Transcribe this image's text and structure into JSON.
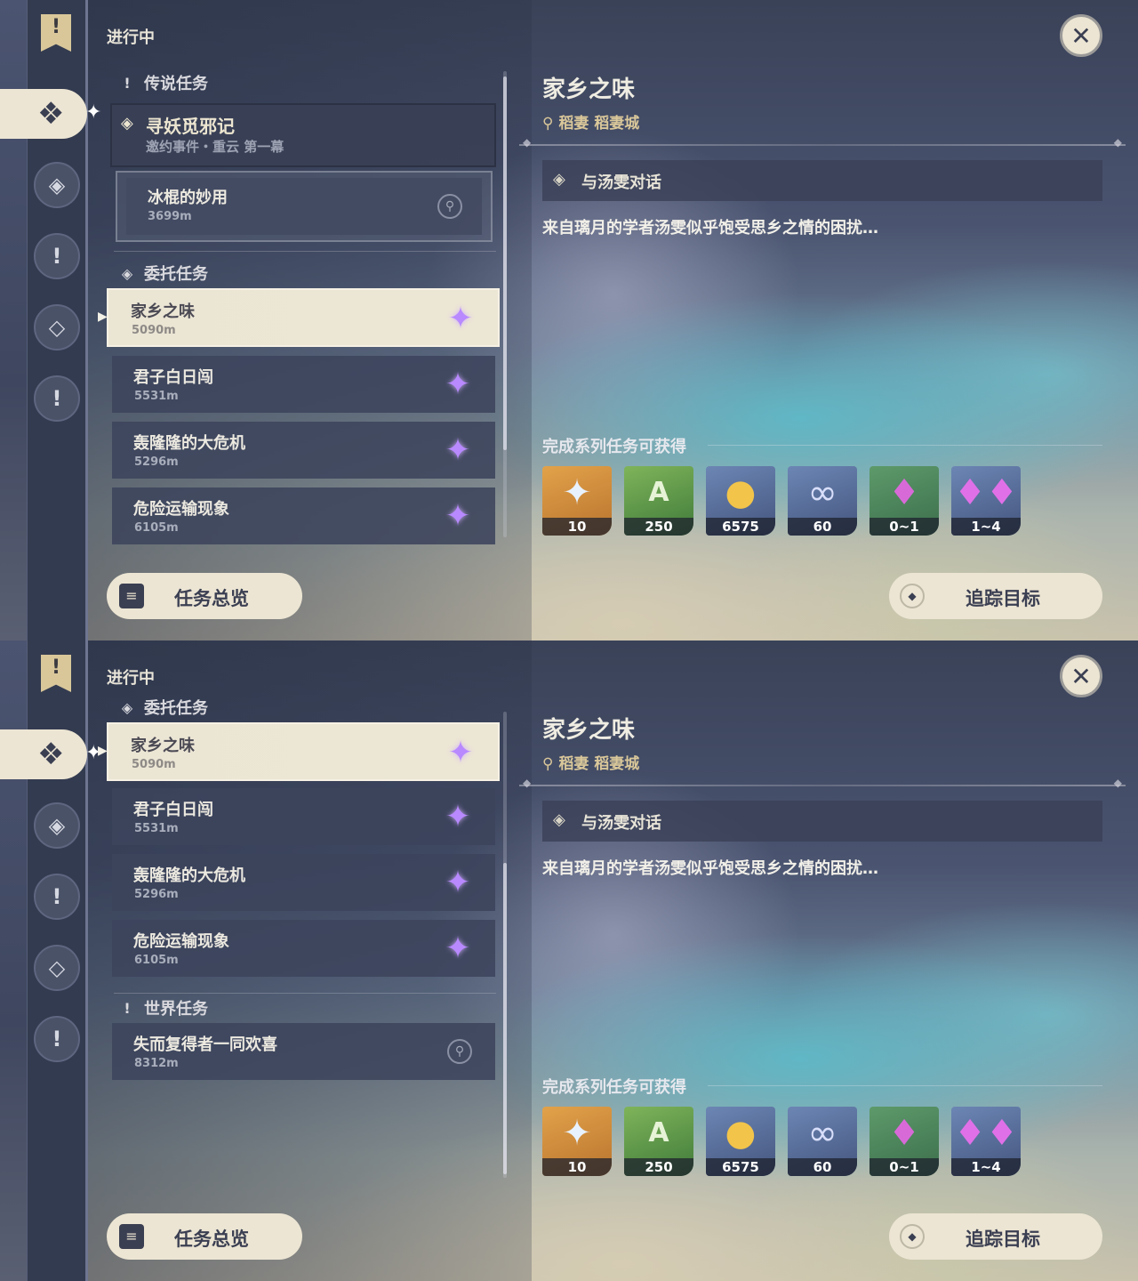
{
  "colors": {
    "accent_cream": "#ece5d3",
    "location_gold": "#d9c79a",
    "quest_purple": "#b889ff",
    "panel_dark": "#3c445c"
  },
  "panel1": {
    "section_label": "进行中",
    "legend_header": "传说任务",
    "legend_quest": {
      "name": "寻妖觅邪记",
      "subtitle": "邀约事件・重云 第一幕"
    },
    "legend_subquest": {
      "name": "冰棍的妙用",
      "distance": "3699m"
    },
    "commission_header": "委托任务",
    "quests": [
      {
        "name": "家乡之味",
        "distance": "5090m"
      },
      {
        "name": "君子白日闯",
        "distance": "5531m"
      },
      {
        "name": "轰隆隆的大危机",
        "distance": "5296m"
      },
      {
        "name": "危险运输现象",
        "distance": "6105m"
      }
    ]
  },
  "panel2": {
    "section_label": "进行中",
    "commission_header": "委托任务",
    "quests": [
      {
        "name": "家乡之味",
        "distance": "5090m"
      },
      {
        "name": "君子白日闯",
        "distance": "5531m"
      },
      {
        "name": "轰隆隆的大危机",
        "distance": "5296m"
      },
      {
        "name": "危险运输现象",
        "distance": "6105m"
      }
    ],
    "world_header": "世界任务",
    "world_quest": {
      "name": "失而复得者一同欢喜",
      "distance": "8312m"
    }
  },
  "detail": {
    "title": "家乡之味",
    "location": "稻妻 稻妻城",
    "step": "与汤雯对话",
    "description": "来自璃月的学者汤雯似乎饱受思乡之情的困扰…",
    "rewards_header": "完成系列任务可获得",
    "rewards": [
      {
        "icon": "primogem-icon",
        "count": "10"
      },
      {
        "icon": "adventure-exp-icon",
        "count": "250"
      },
      {
        "icon": "mora-icon",
        "count": "6575"
      },
      {
        "icon": "companionship-exp-icon",
        "count": "60"
      },
      {
        "icon": "crystal-chunk-icon",
        "count": "0~1"
      },
      {
        "icon": "crystal-cluster-icon",
        "count": "1~4"
      }
    ]
  },
  "buttons": {
    "overview": "任务总览",
    "track": "追踪目标"
  }
}
